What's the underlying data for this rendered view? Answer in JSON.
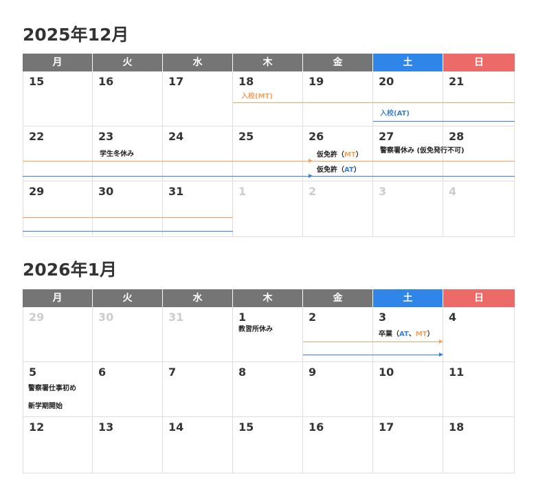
{
  "colors": {
    "header_weekday": "#757575",
    "header_saturday": "#2f86e8",
    "header_sunday": "#ec6a68",
    "mt_line": "#f3a35f",
    "at_line": "#3a7fd4"
  },
  "weekdays": [
    "月",
    "火",
    "水",
    "木",
    "金",
    "土",
    "日"
  ],
  "dec": {
    "title": "2025年12月",
    "row1": [
      "15",
      "16",
      "17",
      "18",
      "19",
      "20",
      "21"
    ],
    "row2": [
      "22",
      "23",
      "24",
      "25",
      "26",
      "27",
      "28"
    ],
    "row3": [
      "29",
      "30",
      "31",
      "1",
      "2",
      "3",
      "4"
    ],
    "events": {
      "nyuko_mt": "入校(MT)",
      "nyuko_at": "入校(AT)",
      "winter_break": "学生冬休み",
      "karimenkyo_prefix": "仮免許（",
      "mt": "MT",
      "at": "AT",
      "close_paren": "）",
      "police_holiday": "警察署休み (仮免発行不可)"
    }
  },
  "jan": {
    "title": "2026年1月",
    "row1": [
      "29",
      "30",
      "31",
      "1",
      "2",
      "3",
      "4"
    ],
    "row2": [
      "5",
      "6",
      "7",
      "8",
      "9",
      "10",
      "11"
    ],
    "row3": [
      "12",
      "13",
      "14",
      "15",
      "16",
      "17",
      "18"
    ],
    "events": {
      "school_closed": "教習所休み",
      "graduation_prefix": "卒業（",
      "at": "AT",
      "comma": "、",
      "mt": "MT",
      "close_paren": "）",
      "police_work_start": "警察署仕事初め",
      "new_term": "新学期開始"
    }
  }
}
